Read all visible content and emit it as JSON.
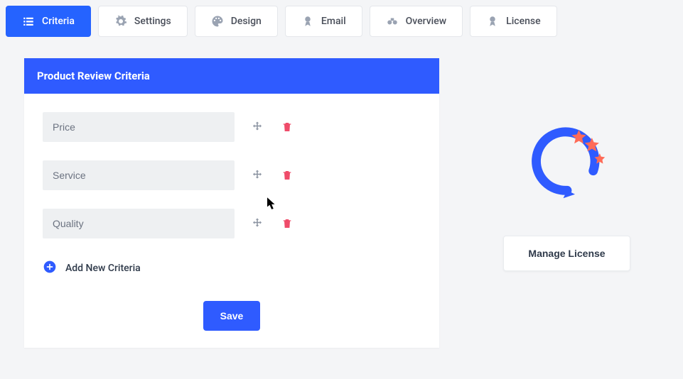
{
  "tabs": [
    {
      "id": "criteria",
      "label": "Criteria",
      "active": true
    },
    {
      "id": "settings",
      "label": "Settings",
      "active": false
    },
    {
      "id": "design",
      "label": "Design",
      "active": false
    },
    {
      "id": "email",
      "label": "Email",
      "active": false
    },
    {
      "id": "overview",
      "label": "Overview",
      "active": false
    },
    {
      "id": "license",
      "label": "License",
      "active": false
    }
  ],
  "panel": {
    "title": "Product Review Criteria",
    "criteria": [
      {
        "name": "Price"
      },
      {
        "name": "Service"
      },
      {
        "name": "Quality"
      }
    ],
    "add_label": "Add New Criteria",
    "save_label": "Save"
  },
  "side": {
    "manage_label": "Manage License"
  }
}
